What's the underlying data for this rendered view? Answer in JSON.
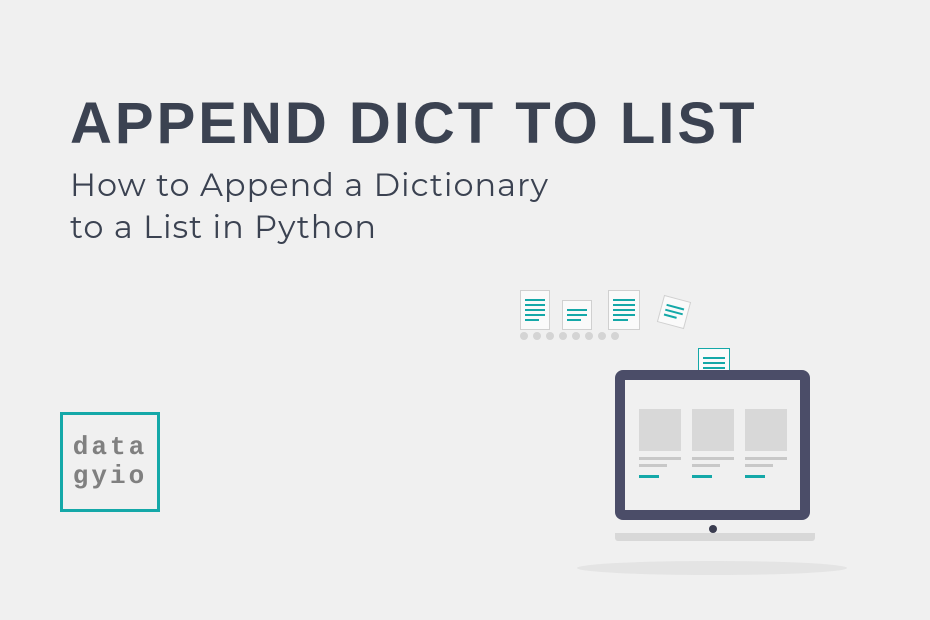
{
  "title": "APPEND DICT TO LIST",
  "subtitle_line1": "How to Append a Dictionary",
  "subtitle_line2": "to a List in Python",
  "logo": {
    "line1": "data",
    "line2": "gyio"
  },
  "colors": {
    "accent": "#14a8a8",
    "text_dark": "#3b4251",
    "bg": "#f0f0f0"
  }
}
